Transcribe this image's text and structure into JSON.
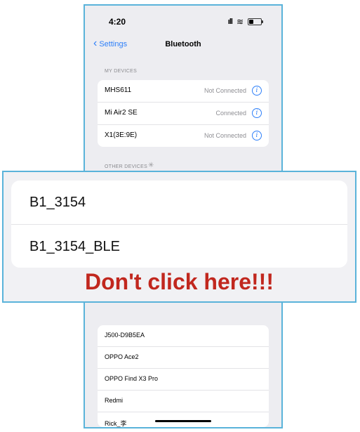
{
  "status_bar": {
    "time": "4:20"
  },
  "nav": {
    "back_label": "Settings",
    "title": "Bluetooth"
  },
  "my_devices": {
    "header": "MY DEVICES",
    "items": [
      {
        "name": "MHS611",
        "status": "Not Connected"
      },
      {
        "name": "Mi Air2 SE",
        "status": "Connected"
      },
      {
        "name": "X1(3E:9E)",
        "status": "Not Connected"
      }
    ]
  },
  "other_devices": {
    "header": "OTHER DEVICES",
    "highlighted": [
      {
        "name": "B1_3154"
      },
      {
        "name": "B1_3154_BLE"
      }
    ],
    "items": [
      {
        "name": "J500-D9B5EA"
      },
      {
        "name": "OPPO Ace2"
      },
      {
        "name": "OPPO Find X3 Pro"
      },
      {
        "name": "Redmi"
      },
      {
        "name": "Rick_李"
      }
    ]
  },
  "annotation": {
    "warning_text": "Don't click here!!!",
    "warning_color": "#c1271e",
    "frame_color": "#5ab3da"
  },
  "icons": {
    "back": "chevron-left-icon",
    "info": "info-circle-icon",
    "spinner": "loading-spinner-icon"
  }
}
